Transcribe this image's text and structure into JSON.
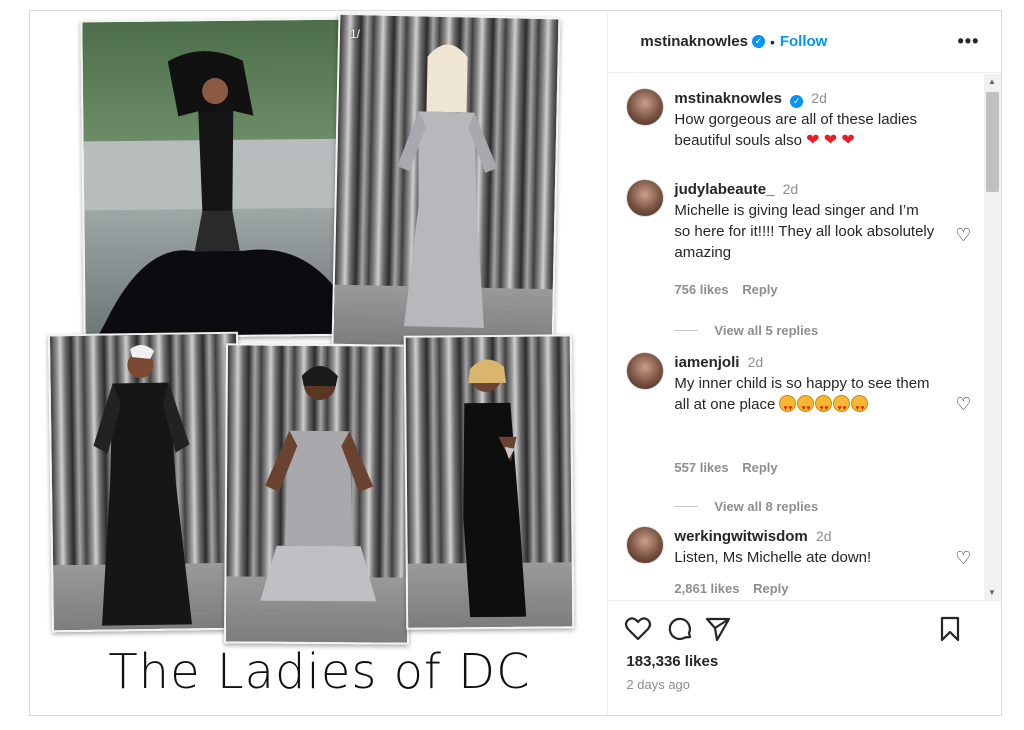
{
  "media": {
    "page_indicator": "1/",
    "caption_art": "The Ladies of DC"
  },
  "header": {
    "username": "mstinaknowles",
    "separator": "•",
    "follow_label": "Follow",
    "more_label": "•••"
  },
  "comments": [
    {
      "username": "mstinaknowles",
      "time": "2d",
      "text": "How gorgeous are all of these ladies beautiful souls also"
    },
    {
      "username": "judylabeaute_",
      "time": "2d",
      "text": "Michelle is giving lead singer and I’m so here for it!!!! They all look absolutely amazing",
      "likes": "756 likes",
      "reply_label": "Reply",
      "view_replies": "View all 5 replies"
    },
    {
      "username": "iamenjoli",
      "time": "2d",
      "text": "My inner child is so happy to see them all at one place",
      "likes": "557 likes",
      "reply_label": "Reply",
      "view_replies": "View all 8 replies"
    },
    {
      "username": "werkingwitwisdom",
      "time": "2d",
      "text": "Listen, Ms Michelle ate down!",
      "likes": "2,861 likes",
      "reply_label": "Reply"
    }
  ],
  "footer": {
    "likes": "183,336 likes",
    "posted": "2 days ago"
  },
  "icons": {
    "like": "heart-icon",
    "comment": "comment-bubble-icon",
    "share": "paper-plane-icon",
    "save": "bookmark-icon",
    "verified": "verified-badge-icon"
  },
  "colors": {
    "accent": "#0095f6",
    "text": "#262626",
    "muted": "#8e8e8e",
    "emoji_heart": "#ed1c24"
  }
}
